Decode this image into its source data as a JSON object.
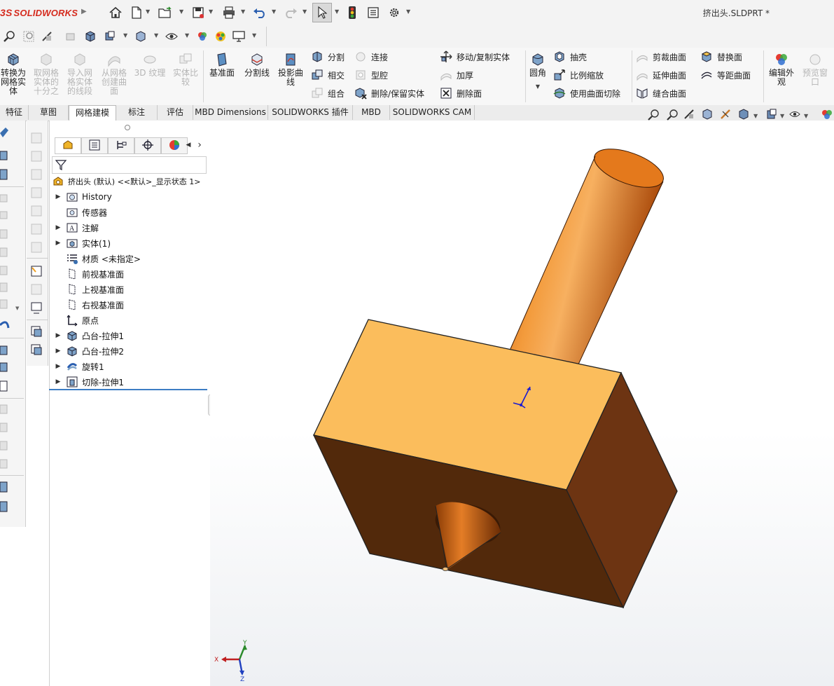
{
  "app": {
    "logo_text": "SOLIDWORKS",
    "logo_prefix": "3S"
  },
  "document": {
    "title": "挤出头.SLDPRT *"
  },
  "command_manager": {
    "mesh_group": [
      {
        "label": "转换为网格实体",
        "lines": [
          "转换为",
          "网格实",
          "体"
        ],
        "enabled": true
      },
      {
        "label": "取网格实体的十分之",
        "lines": [
          "取网格",
          "实体的",
          "十分之"
        ],
        "enabled": false
      },
      {
        "label": "导入网格实体的线段",
        "lines": [
          "导入网",
          "格实体",
          "的线段"
        ],
        "enabled": false
      },
      {
        "label": "从网格创建曲面",
        "lines": [
          "从网格",
          "创建曲",
          "面"
        ],
        "enabled": false
      },
      {
        "label": "3D 纹理",
        "lines": [
          "3D 纹理"
        ],
        "enabled": false
      },
      {
        "label": "实体比较",
        "lines": [
          "实体比",
          "较"
        ],
        "enabled": false
      }
    ],
    "ref_group": [
      {
        "label": "基准面",
        "lines": [
          "基准面"
        ]
      },
      {
        "label": "分割线",
        "lines": [
          "分割线"
        ]
      },
      {
        "label": "投影曲线",
        "lines": [
          "投影曲",
          "线"
        ]
      }
    ],
    "small_col1": [
      {
        "label": "分割",
        "enabled": true
      },
      {
        "label": "相交",
        "enabled": true
      },
      {
        "label": "组合",
        "enabled": false
      }
    ],
    "small_col2": [
      {
        "label": "连接",
        "enabled": false
      },
      {
        "label": "型腔",
        "enabled": false
      },
      {
        "label": "删除/保留实体",
        "enabled": true
      }
    ],
    "small_col3": [
      {
        "label": "移动/复制实体",
        "enabled": true
      },
      {
        "label": "加厚",
        "enabled": false
      },
      {
        "label": "删除面",
        "enabled": true
      }
    ],
    "fillet": {
      "label": "圆角"
    },
    "small_col4": [
      {
        "label": "抽壳",
        "enabled": true
      },
      {
        "label": "比例缩放",
        "enabled": true
      },
      {
        "label": "使用曲面切除",
        "enabled": true
      }
    ],
    "small_col5": [
      {
        "label": "剪裁曲面",
        "enabled": false
      },
      {
        "label": "延伸曲面",
        "enabled": false
      },
      {
        "label": "缝合曲面",
        "enabled": true
      }
    ],
    "small_col6": [
      {
        "label": "替换面",
        "enabled": true
      },
      {
        "label": "等距曲面",
        "enabled": true
      }
    ],
    "appearance": {
      "lines": [
        "编辑外",
        "观"
      ]
    },
    "preview": {
      "lines": [
        "预览窗",
        "口"
      ]
    }
  },
  "tabs": [
    {
      "label": "特征",
      "active": false
    },
    {
      "label": "草图",
      "active": false
    },
    {
      "label": "网格建模",
      "active": true
    },
    {
      "label": "标注",
      "active": false
    },
    {
      "label": "评估",
      "active": false
    },
    {
      "label": "MBD Dimensions",
      "active": false
    },
    {
      "label": "SOLIDWORKS 插件",
      "active": false
    },
    {
      "label": "MBD",
      "active": false
    },
    {
      "label": "SOLIDWORKS CAM",
      "active": false
    }
  ],
  "feature_tree": {
    "root": "挤出头 (默认) <<默认>_显示状态 1>",
    "items": [
      {
        "label": "History",
        "expandable": true,
        "icon": "history-folder-icon"
      },
      {
        "label": "传感器",
        "expandable": false,
        "icon": "sensor-folder-icon"
      },
      {
        "label": "注解",
        "expandable": true,
        "icon": "annotation-folder-icon"
      },
      {
        "label": "实体(1)",
        "expandable": true,
        "icon": "solid-bodies-folder-icon"
      },
      {
        "label": "材质 <未指定>",
        "expandable": false,
        "icon": "material-icon"
      },
      {
        "label": "前视基准面",
        "expandable": false,
        "icon": "plane-icon"
      },
      {
        "label": "上视基准面",
        "expandable": false,
        "icon": "plane-icon"
      },
      {
        "label": "右视基准面",
        "expandable": false,
        "icon": "plane-icon"
      },
      {
        "label": "原点",
        "expandable": false,
        "icon": "origin-icon"
      },
      {
        "label": "凸台-拉伸1",
        "expandable": true,
        "icon": "boss-extrude-icon"
      },
      {
        "label": "凸台-拉伸2",
        "expandable": true,
        "icon": "boss-extrude-icon"
      },
      {
        "label": "旋转1",
        "expandable": true,
        "icon": "revolve-icon"
      },
      {
        "label": "切除-拉伸1",
        "expandable": true,
        "icon": "cut-extrude-icon"
      }
    ]
  },
  "triad": {
    "x": "X",
    "y": "Y",
    "z": "Z"
  },
  "colors": {
    "model_top": "#fbbd5c",
    "model_front": "#52290b",
    "model_side": "#6d3412",
    "cylinder": "#e88323",
    "accent_blue": "#3c7dc4"
  }
}
